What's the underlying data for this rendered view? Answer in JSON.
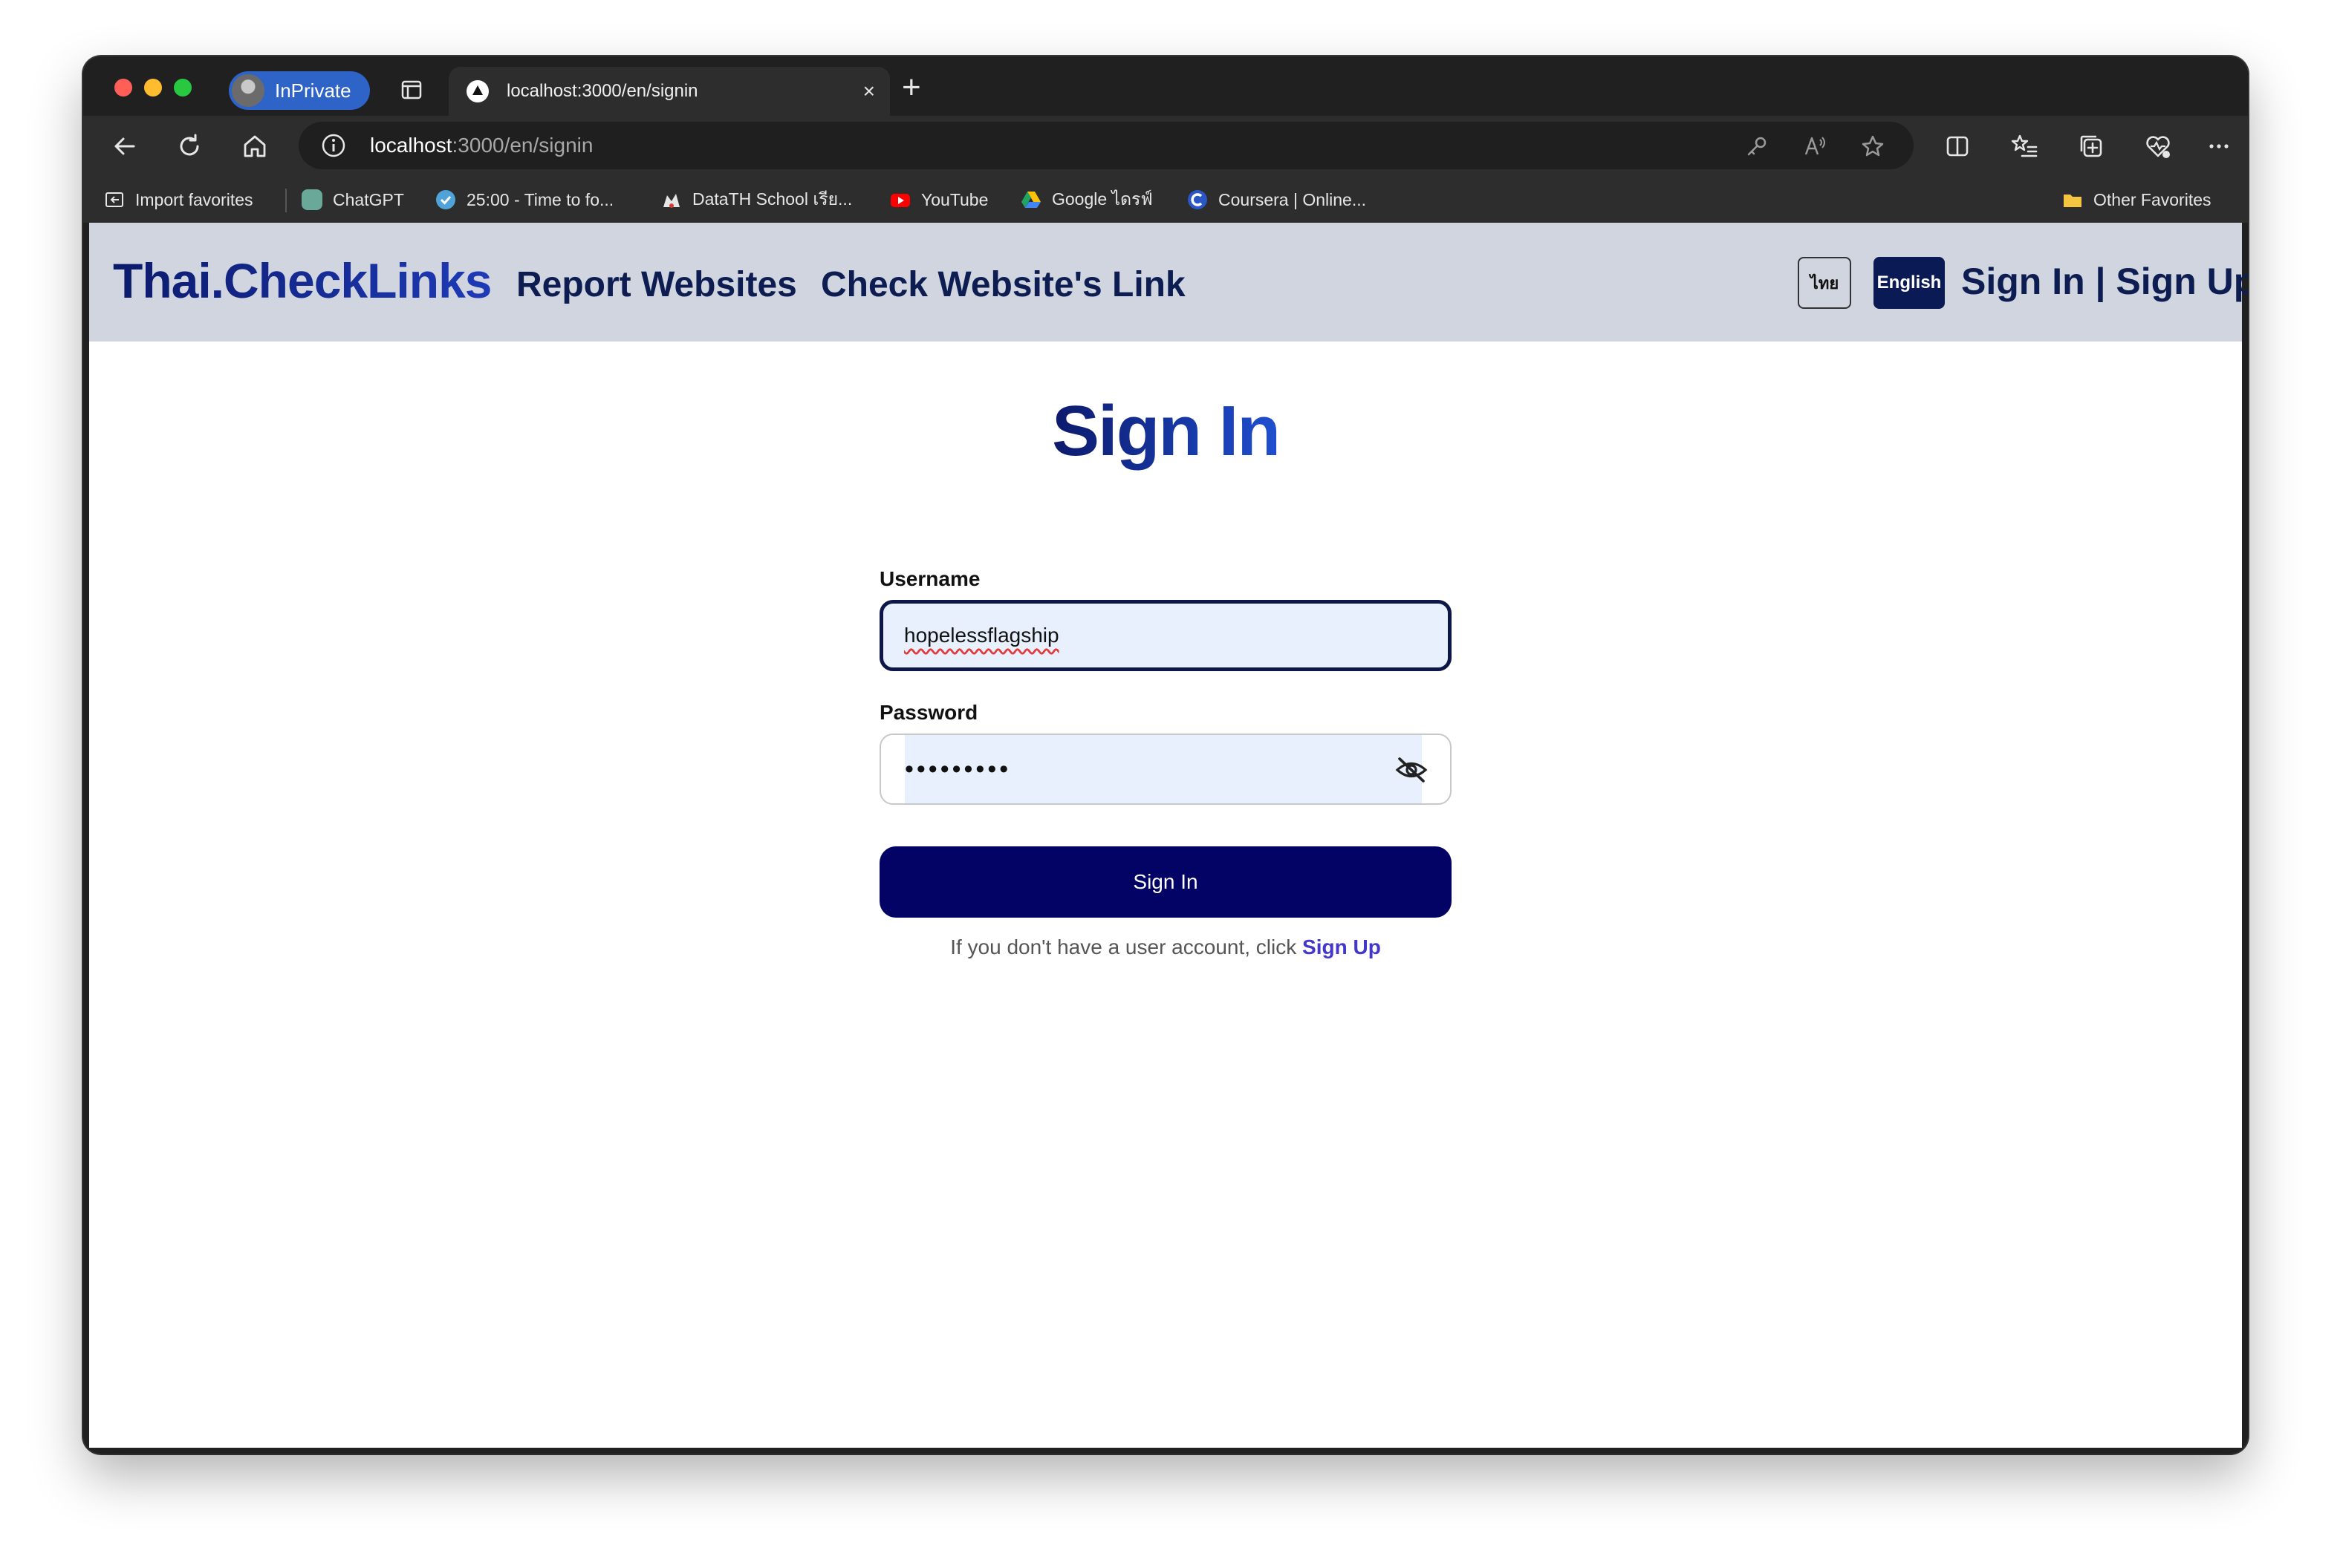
{
  "browser": {
    "profile_label": "InPrivate",
    "tab_title": "localhost:3000/en/signin",
    "tab_close": "×",
    "new_tab": "+",
    "url_host": "localhost",
    "url_rest": ":3000/en/signin",
    "favorites": [
      {
        "label": "Import favorites",
        "icon": "import-favorites-icon"
      },
      {
        "label": "ChatGPT",
        "icon": "chatgpt-icon"
      },
      {
        "label": "25:00 - Time to fo...",
        "icon": "check-circle-icon"
      },
      {
        "label": "DataTH School เรีย...",
        "icon": "datath-icon"
      },
      {
        "label": "YouTube",
        "icon": "youtube-icon"
      },
      {
        "label": "Google ไดรฟ์",
        "icon": "google-drive-icon"
      },
      {
        "label": "Coursera | Online...",
        "icon": "coursera-icon"
      }
    ],
    "other_favorites": "Other Favorites"
  },
  "site": {
    "brand": "Thai.CheckLinks",
    "nav": [
      "Report Websites",
      "Check Website's Link"
    ],
    "lang_th": "ไทย",
    "lang_en": "English",
    "auth": "Sign In | Sign Up"
  },
  "signin": {
    "heading": "Sign In",
    "username_label": "Username",
    "username_value": "hopelessflagship",
    "password_label": "Password",
    "password_value": "•••••••••",
    "submit_label": "Sign In",
    "hint_text": "If you don't have a user account, click ",
    "hint_link": "Sign Up"
  },
  "colors": {
    "nav_bg": "#d0d5df",
    "brand_dark": "#0c1a6b",
    "brand_light": "#1f4fd0",
    "button": "#030366",
    "link": "#4338ca"
  }
}
